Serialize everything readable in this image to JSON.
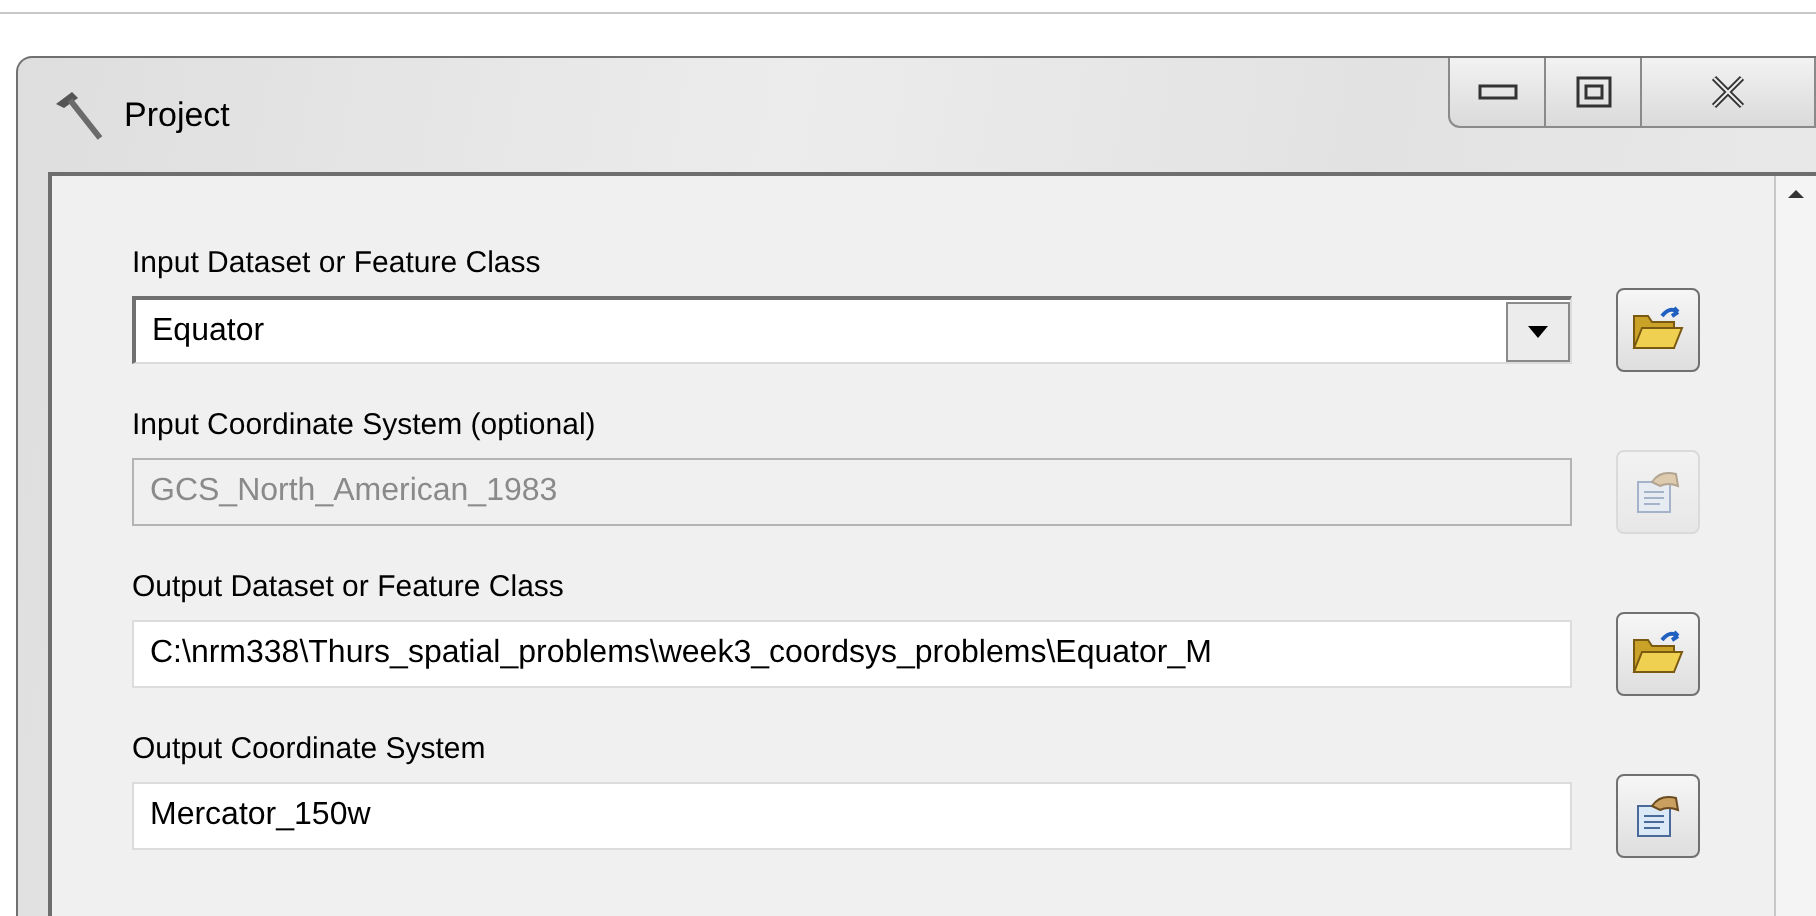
{
  "window": {
    "title": "Project"
  },
  "fields": [
    {
      "label": "Input Dataset or Feature Class",
      "kind": "combo",
      "value": "Equator",
      "disabled": false,
      "button": {
        "kind": "folder"
      }
    },
    {
      "label": "Input Coordinate System (optional)",
      "kind": "text",
      "value": "GCS_North_American_1983",
      "disabled": true,
      "button": {
        "kind": "properties"
      }
    },
    {
      "label": "Output Dataset or Feature Class",
      "kind": "text",
      "value": "C:\\nrm338\\Thurs_spatial_problems\\week3_coordsys_problems\\Equator_M",
      "disabled": false,
      "button": {
        "kind": "folder"
      }
    },
    {
      "label": "Output Coordinate System",
      "kind": "text",
      "value": "Mercator_150w",
      "disabled": false,
      "button": {
        "kind": "properties"
      }
    }
  ]
}
